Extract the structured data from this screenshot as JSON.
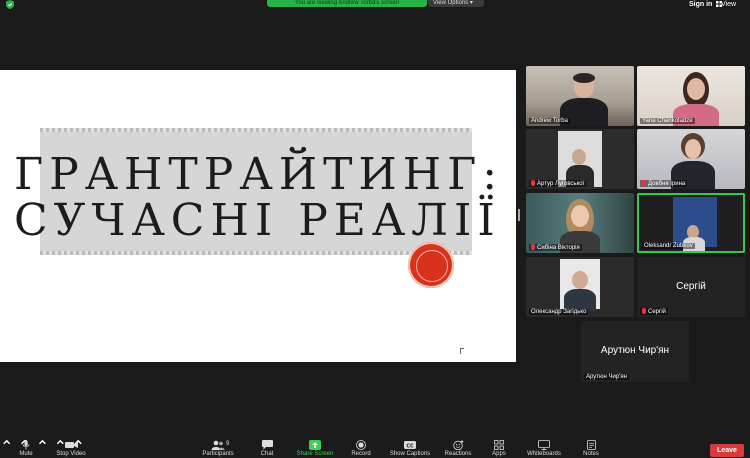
{
  "top_bar": {
    "viewing_banner": "You are viewing Andrew Torba's screen",
    "view_options": "View Options",
    "sign_in": "Sign in",
    "view": "View"
  },
  "slide": {
    "title_line1": "ГРАНТРАЙТИНГ:",
    "title_line2": "СУЧАСНІ РЕАЛІЇ"
  },
  "participants": [
    {
      "name": "Andrew Torba",
      "muted": false,
      "video": true
    },
    {
      "name": "Yana Chankotadze",
      "muted": false,
      "video": true
    },
    {
      "name": "Артур Луговської",
      "muted": true,
      "video": true
    },
    {
      "name": "Довбня Ірина",
      "muted": true,
      "video": true
    },
    {
      "name": "Сибіна Вікторія",
      "muted": true,
      "video": true
    },
    {
      "name": "Oleksandr Zubkov",
      "muted": false,
      "video": true,
      "active_speaker": true
    },
    {
      "name": "Олександр Загідько",
      "muted": false,
      "video": true
    },
    {
      "name": "Сергій",
      "display_name": "Сергій",
      "muted": true,
      "video": false
    },
    {
      "name": "Арутюн Чир'ян",
      "display_name": "Арутюн Чир'ян",
      "muted": false,
      "video": false
    }
  ],
  "toolbar": {
    "mute": "Mute",
    "stop_video": "Stop Video",
    "participants": "Participants",
    "participants_count": "9",
    "chat": "Chat",
    "share_screen": "Share Screen",
    "record": "Record",
    "show_captions": "Show Captions",
    "reactions": "Reactions",
    "apps": "Apps",
    "whiteboards": "Whiteboards",
    "notes": "Notes",
    "leave": "Leave"
  },
  "colors": {
    "active_speaker_border": "#37c853",
    "share_screen_green": "#3ad15a",
    "banner_green": "#2ab24a",
    "leave_red": "#d83b3b",
    "muted_red": "#e33333"
  }
}
